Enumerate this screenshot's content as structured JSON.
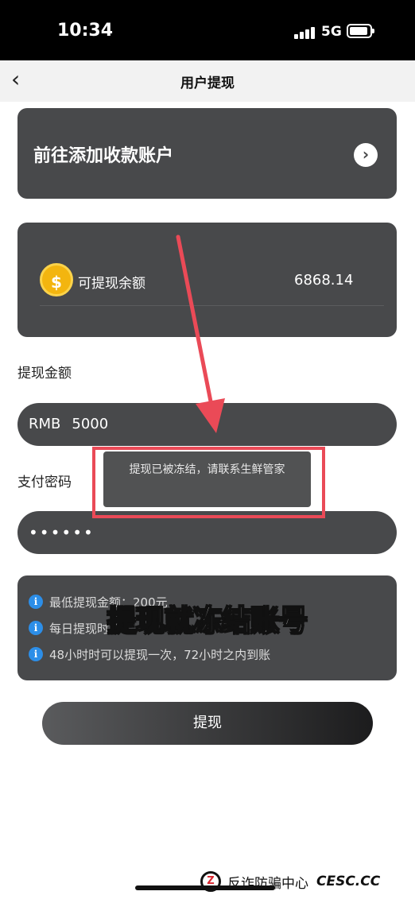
{
  "status_bar": {
    "time": "10:34",
    "network": "5G"
  },
  "nav": {
    "back_icon": "chevron-left-icon",
    "title": "用户提现"
  },
  "add_account": {
    "label": "前往添加收款账户",
    "icon": "chevron-right-circle-icon"
  },
  "balance": {
    "label": "可提现余额",
    "value": "6868.14",
    "icon": "money-bag-icon",
    "icon_color": "#f3b50f"
  },
  "amount": {
    "label": "提现金额",
    "currency": "RMB",
    "value": "5000"
  },
  "password": {
    "label": "支付密码",
    "value": "••••••"
  },
  "rules": [
    "最低提现金额：200元",
    "每日提现时间",
    "48小时时可以提现一次，72小时之内到账"
  ],
  "submit": {
    "label": "提现"
  },
  "toast": {
    "message": "提现已被冻结，请联系生鲜管家"
  },
  "overlay": {
    "caption": "提现就冻结账号",
    "highlight_color": "#ea4a57"
  },
  "watermark": {
    "text": "反诈防骗中心",
    "site": "CESC.CC"
  }
}
